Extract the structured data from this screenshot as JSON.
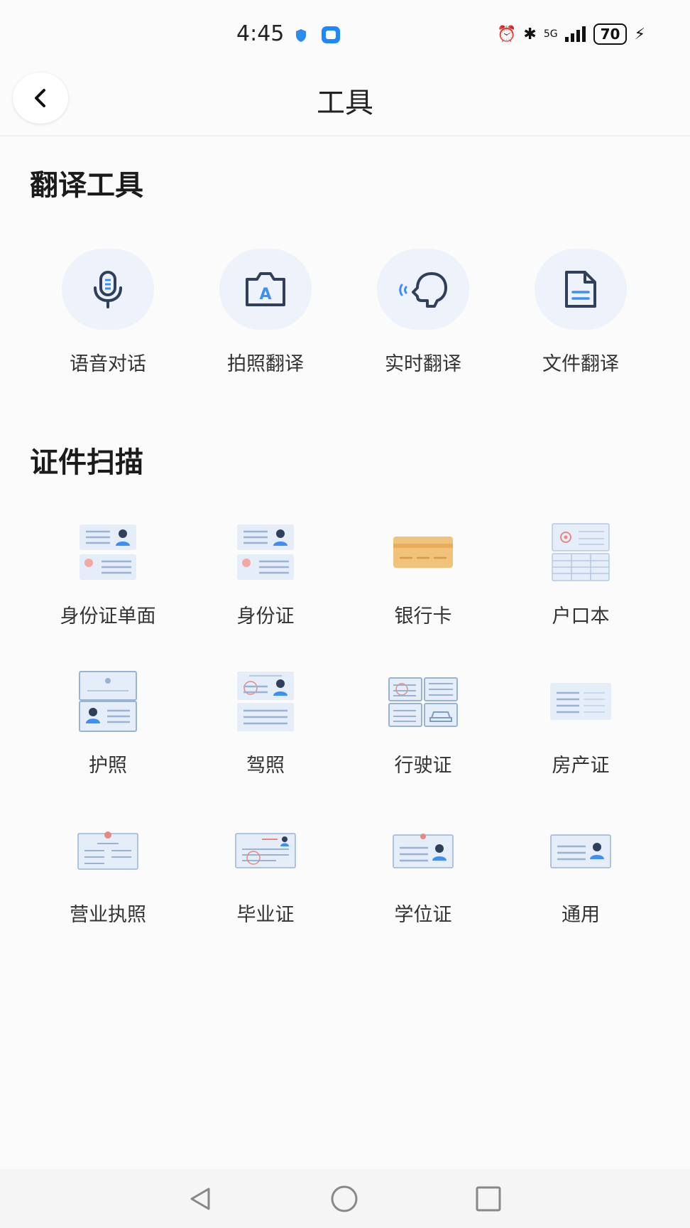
{
  "status_bar": {
    "time": "4:45",
    "network": "5G",
    "battery": "70"
  },
  "header": {
    "title": "工具"
  },
  "translate_section": {
    "title": "翻译工具",
    "tools": [
      {
        "label": "语音对话",
        "icon": "microphone-icon"
      },
      {
        "label": "拍照翻译",
        "icon": "camera-translate-icon"
      },
      {
        "label": "实时翻译",
        "icon": "live-voice-icon"
      },
      {
        "label": "文件翻译",
        "icon": "document-icon"
      }
    ]
  },
  "scan_section": {
    "title": "证件扫描",
    "documents": [
      {
        "label": "身份证单面",
        "icon": "id-card-single-icon"
      },
      {
        "label": "身份证",
        "icon": "id-card-icon"
      },
      {
        "label": "银行卡",
        "icon": "bank-card-icon"
      },
      {
        "label": "户口本",
        "icon": "household-register-icon"
      },
      {
        "label": "护照",
        "icon": "passport-icon"
      },
      {
        "label": "驾照",
        "icon": "driver-license-icon"
      },
      {
        "label": "行驶证",
        "icon": "vehicle-license-icon"
      },
      {
        "label": "房产证",
        "icon": "property-certificate-icon"
      },
      {
        "label": "营业执照",
        "icon": "business-license-icon"
      },
      {
        "label": "毕业证",
        "icon": "graduation-certificate-icon"
      },
      {
        "label": "学位证",
        "icon": "degree-certificate-icon"
      },
      {
        "label": "通用",
        "icon": "general-document-icon"
      }
    ]
  },
  "colors": {
    "accent": "#2f3f5c",
    "icon_bg": "#eef2fa",
    "card_blue": "#e4edf8",
    "card_gold": "#f0c27a"
  }
}
